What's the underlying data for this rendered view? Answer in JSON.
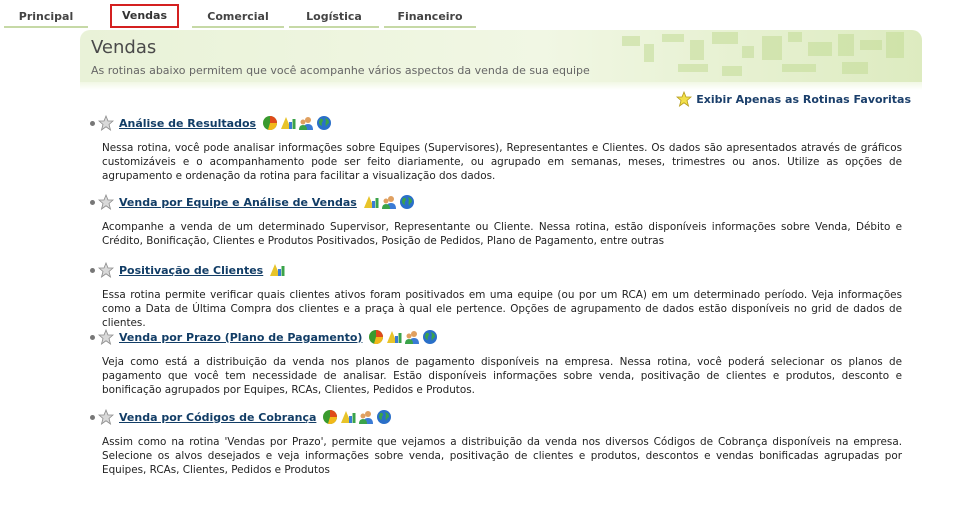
{
  "tabs": [
    {
      "label": "Principal",
      "active": false
    },
    {
      "label": "Vendas",
      "active": true
    },
    {
      "label": "Comercial",
      "active": false
    },
    {
      "label": "Logística",
      "active": false
    },
    {
      "label": "Financeiro",
      "active": false
    }
  ],
  "header": {
    "title": "Vendas",
    "subtitle": "As rotinas abaixo permitem que você acompanhe vários aspectos da venda de sua equipe"
  },
  "favorites_link": "Exibir Apenas as Rotinas Favoritas",
  "routines": [
    {
      "title": "Análise de Resultados",
      "icons": [
        "pie-chart-icon",
        "chart-triangle-icon",
        "users-icon",
        "globe-icon"
      ],
      "description": "Nessa rotina, você pode analisar informações sobre Equipes (Supervisores), Representantes e Clientes. Os dados são apresentados através de gráficos customizáveis e o acompanhamento pode ser feito diariamente, ou agrupado em semanas, meses, trimestres ou anos. Utilize as opções de agrupamento e ordenação da rotina para facilitar a visualização dos dados."
    },
    {
      "title": "Venda por Equipe e Análise de Vendas",
      "icons": [
        "chart-triangle-icon",
        "users-icon",
        "globe-icon"
      ],
      "description": "Acompanhe a venda de um determinado Supervisor, Representante ou Cliente. Nessa rotina, estão disponíveis informações sobre Venda, Débito e Crédito, Bonificação, Clientes e Produtos Positivados, Posição de Pedidos, Plano de Pagamento, entre outras"
    },
    {
      "title": "Positivação de Clientes",
      "icons": [
        "chart-triangle-icon"
      ],
      "description": "Essa rotina permite verificar quais clientes ativos foram positivados em uma equipe (ou por um RCA) em um determinado período. Veja informações como a Data de Última Compra dos clientes e a praça à qual ele pertence. Opções de agrupamento de dados estão disponíveis no grid de dados de clientes."
    },
    {
      "title": "Venda por Prazo (Plano de Pagamento)",
      "icons": [
        "pie-chart-icon",
        "chart-triangle-icon",
        "users-icon",
        "globe-icon"
      ],
      "description": "Veja como está a distribuição da venda nos planos de pagamento disponíveis na empresa. Nessa rotina, você poderá selecionar os planos de pagamento que você tem necessidade de analisar. Estão disponíveis informações sobre venda, positivação de clientes e produtos, desconto e bonificação agrupados por Equipes, RCAs, Clientes, Pedidos e Produtos."
    },
    {
      "title": "Venda por Códigos de Cobrança",
      "icons": [
        "pie-chart-icon",
        "chart-triangle-icon",
        "users-icon",
        "globe-icon"
      ],
      "description": "Assim como na rotina 'Vendas por Prazo', permite que vejamos a distribuição da venda nos diversos Códigos de Cobrança disponíveis na empresa. Selecione os alvos desejados e veja informações sobre venda, positivação de clientes e produtos, descontos e vendas bonificadas agrupadas por Equipes, RCAs, Clientes, Pedidos e Produtos"
    }
  ]
}
